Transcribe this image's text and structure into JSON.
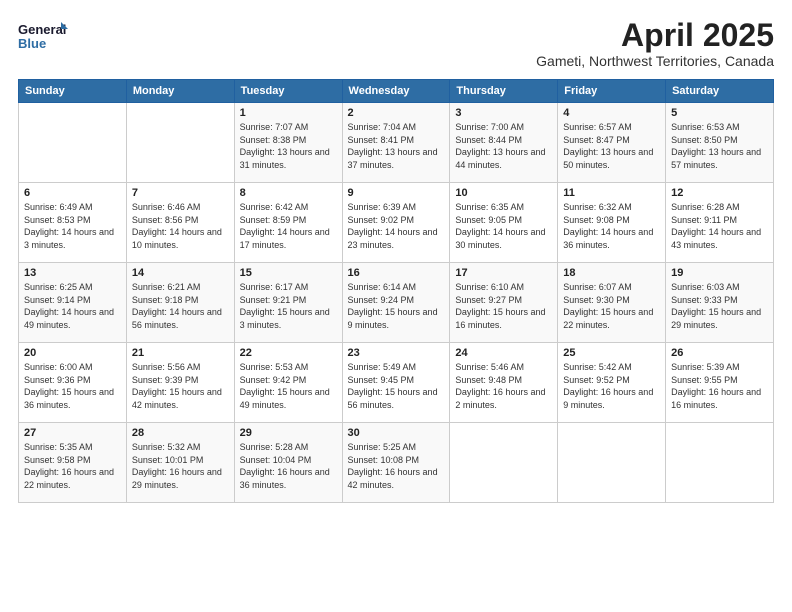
{
  "header": {
    "logo_line1": "General",
    "logo_line2": "Blue",
    "title": "April 2025",
    "subtitle": "Gameti, Northwest Territories, Canada"
  },
  "calendar": {
    "days_of_week": [
      "Sunday",
      "Monday",
      "Tuesday",
      "Wednesday",
      "Thursday",
      "Friday",
      "Saturday"
    ],
    "weeks": [
      [
        {
          "day": "",
          "info": ""
        },
        {
          "day": "",
          "info": ""
        },
        {
          "day": "1",
          "info": "Sunrise: 7:07 AM\nSunset: 8:38 PM\nDaylight: 13 hours and 31 minutes."
        },
        {
          "day": "2",
          "info": "Sunrise: 7:04 AM\nSunset: 8:41 PM\nDaylight: 13 hours and 37 minutes."
        },
        {
          "day": "3",
          "info": "Sunrise: 7:00 AM\nSunset: 8:44 PM\nDaylight: 13 hours and 44 minutes."
        },
        {
          "day": "4",
          "info": "Sunrise: 6:57 AM\nSunset: 8:47 PM\nDaylight: 13 hours and 50 minutes."
        },
        {
          "day": "5",
          "info": "Sunrise: 6:53 AM\nSunset: 8:50 PM\nDaylight: 13 hours and 57 minutes."
        }
      ],
      [
        {
          "day": "6",
          "info": "Sunrise: 6:49 AM\nSunset: 8:53 PM\nDaylight: 14 hours and 3 minutes."
        },
        {
          "day": "7",
          "info": "Sunrise: 6:46 AM\nSunset: 8:56 PM\nDaylight: 14 hours and 10 minutes."
        },
        {
          "day": "8",
          "info": "Sunrise: 6:42 AM\nSunset: 8:59 PM\nDaylight: 14 hours and 17 minutes."
        },
        {
          "day": "9",
          "info": "Sunrise: 6:39 AM\nSunset: 9:02 PM\nDaylight: 14 hours and 23 minutes."
        },
        {
          "day": "10",
          "info": "Sunrise: 6:35 AM\nSunset: 9:05 PM\nDaylight: 14 hours and 30 minutes."
        },
        {
          "day": "11",
          "info": "Sunrise: 6:32 AM\nSunset: 9:08 PM\nDaylight: 14 hours and 36 minutes."
        },
        {
          "day": "12",
          "info": "Sunrise: 6:28 AM\nSunset: 9:11 PM\nDaylight: 14 hours and 43 minutes."
        }
      ],
      [
        {
          "day": "13",
          "info": "Sunrise: 6:25 AM\nSunset: 9:14 PM\nDaylight: 14 hours and 49 minutes."
        },
        {
          "day": "14",
          "info": "Sunrise: 6:21 AM\nSunset: 9:18 PM\nDaylight: 14 hours and 56 minutes."
        },
        {
          "day": "15",
          "info": "Sunrise: 6:17 AM\nSunset: 9:21 PM\nDaylight: 15 hours and 3 minutes."
        },
        {
          "day": "16",
          "info": "Sunrise: 6:14 AM\nSunset: 9:24 PM\nDaylight: 15 hours and 9 minutes."
        },
        {
          "day": "17",
          "info": "Sunrise: 6:10 AM\nSunset: 9:27 PM\nDaylight: 15 hours and 16 minutes."
        },
        {
          "day": "18",
          "info": "Sunrise: 6:07 AM\nSunset: 9:30 PM\nDaylight: 15 hours and 22 minutes."
        },
        {
          "day": "19",
          "info": "Sunrise: 6:03 AM\nSunset: 9:33 PM\nDaylight: 15 hours and 29 minutes."
        }
      ],
      [
        {
          "day": "20",
          "info": "Sunrise: 6:00 AM\nSunset: 9:36 PM\nDaylight: 15 hours and 36 minutes."
        },
        {
          "day": "21",
          "info": "Sunrise: 5:56 AM\nSunset: 9:39 PM\nDaylight: 15 hours and 42 minutes."
        },
        {
          "day": "22",
          "info": "Sunrise: 5:53 AM\nSunset: 9:42 PM\nDaylight: 15 hours and 49 minutes."
        },
        {
          "day": "23",
          "info": "Sunrise: 5:49 AM\nSunset: 9:45 PM\nDaylight: 15 hours and 56 minutes."
        },
        {
          "day": "24",
          "info": "Sunrise: 5:46 AM\nSunset: 9:48 PM\nDaylight: 16 hours and 2 minutes."
        },
        {
          "day": "25",
          "info": "Sunrise: 5:42 AM\nSunset: 9:52 PM\nDaylight: 16 hours and 9 minutes."
        },
        {
          "day": "26",
          "info": "Sunrise: 5:39 AM\nSunset: 9:55 PM\nDaylight: 16 hours and 16 minutes."
        }
      ],
      [
        {
          "day": "27",
          "info": "Sunrise: 5:35 AM\nSunset: 9:58 PM\nDaylight: 16 hours and 22 minutes."
        },
        {
          "day": "28",
          "info": "Sunrise: 5:32 AM\nSunset: 10:01 PM\nDaylight: 16 hours and 29 minutes."
        },
        {
          "day": "29",
          "info": "Sunrise: 5:28 AM\nSunset: 10:04 PM\nDaylight: 16 hours and 36 minutes."
        },
        {
          "day": "30",
          "info": "Sunrise: 5:25 AM\nSunset: 10:08 PM\nDaylight: 16 hours and 42 minutes."
        },
        {
          "day": "",
          "info": ""
        },
        {
          "day": "",
          "info": ""
        },
        {
          "day": "",
          "info": ""
        }
      ]
    ]
  }
}
